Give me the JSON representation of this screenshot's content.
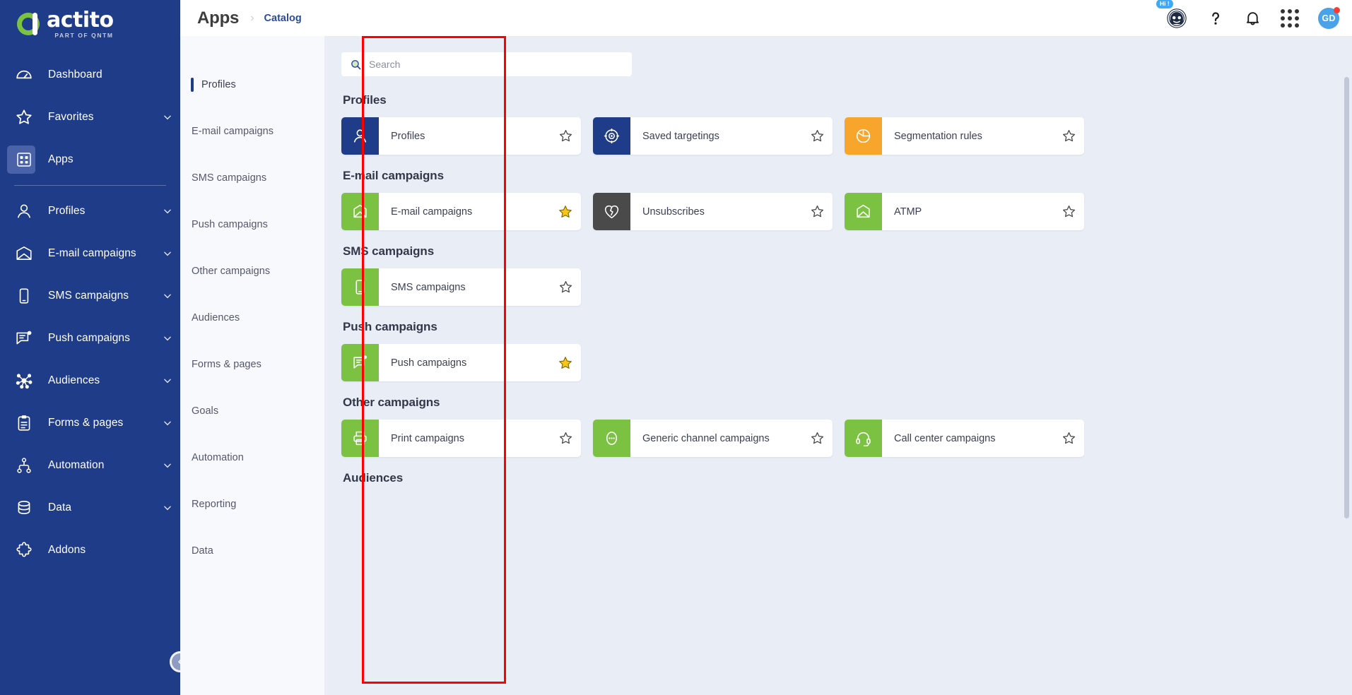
{
  "brand": {
    "name": "actito",
    "tagline": "PART OF QNTM",
    "sidebar_bg": "#1f3c88",
    "accent_green": "#7cc242",
    "accent_orange": "#f7a52b"
  },
  "sidebar": {
    "items": [
      {
        "label": "Dashboard",
        "icon": "dashboard-icon",
        "chevron": false,
        "active": false
      },
      {
        "label": "Favorites",
        "icon": "star-icon",
        "chevron": true,
        "active": false
      },
      {
        "label": "Apps",
        "icon": "apps-grid-icon",
        "chevron": false,
        "active": true
      },
      {
        "label": "Profiles",
        "icon": "person-icon",
        "chevron": true,
        "active": false
      },
      {
        "label": "E-mail campaigns",
        "icon": "envelope-icon",
        "chevron": true,
        "active": false
      },
      {
        "label": "SMS campaigns",
        "icon": "mobile-icon",
        "chevron": true,
        "active": false
      },
      {
        "label": "Push campaigns",
        "icon": "push-message-icon",
        "chevron": true,
        "active": false
      },
      {
        "label": "Audiences",
        "icon": "network-nodes-icon",
        "chevron": true,
        "active": false
      },
      {
        "label": "Forms & pages",
        "icon": "clipboard-icon",
        "chevron": true,
        "active": false
      },
      {
        "label": "Automation",
        "icon": "sitemap-icon",
        "chevron": true,
        "active": false
      },
      {
        "label": "Data",
        "icon": "database-icon",
        "chevron": true,
        "active": false
      },
      {
        "label": "Addons",
        "icon": "puzzle-icon",
        "chevron": false,
        "active": false
      }
    ],
    "collapse_icon": "chevron-left-icon"
  },
  "header": {
    "title": "Apps",
    "separator": "›",
    "breadcrumb_current": "Catalog",
    "icons": [
      {
        "name": "chatbot-icon",
        "badge": "Hi !"
      },
      {
        "name": "help-question-icon",
        "badge": ""
      },
      {
        "name": "notification-bell-icon",
        "badge": ""
      },
      {
        "name": "apps-grid-icon",
        "badge": ""
      }
    ],
    "avatar_initials": "GD",
    "avatar_color": "#4aa3e8",
    "avatar_dot_color": "#ff3b30"
  },
  "catalog_nav": {
    "highlight_color": "#ff0000",
    "items": [
      {
        "label": "Profiles",
        "active": true
      },
      {
        "label": "E-mail campaigns",
        "active": false
      },
      {
        "label": "SMS campaigns",
        "active": false
      },
      {
        "label": "Push campaigns",
        "active": false
      },
      {
        "label": "Other campaigns",
        "active": false
      },
      {
        "label": "Audiences",
        "active": false
      },
      {
        "label": "Forms & pages",
        "active": false
      },
      {
        "label": "Goals",
        "active": false
      },
      {
        "label": "Automation",
        "active": false
      },
      {
        "label": "Reporting",
        "active": false
      },
      {
        "label": "Data",
        "active": false
      }
    ]
  },
  "search": {
    "placeholder": "Search",
    "value": "",
    "icon": "search-icon"
  },
  "sections": [
    {
      "title": "Profiles",
      "cards": [
        {
          "label": "Profiles",
          "icon": "person-icon",
          "color": "bg-navy",
          "favorite": false
        },
        {
          "label": "Saved targetings",
          "icon": "target-icon",
          "color": "bg-navy",
          "favorite": false
        },
        {
          "label": "Segmentation rules",
          "icon": "pie-chart-icon",
          "color": "bg-orange",
          "favorite": false
        }
      ]
    },
    {
      "title": "E-mail campaigns",
      "cards": [
        {
          "label": "E-mail campaigns",
          "icon": "envelope-icon",
          "color": "bg-green",
          "favorite": true
        },
        {
          "label": "Unsubscribes",
          "icon": "broken-heart-icon",
          "color": "bg-dark",
          "favorite": false
        },
        {
          "label": "ATMP",
          "icon": "envelope-icon",
          "color": "bg-green",
          "favorite": false
        }
      ]
    },
    {
      "title": "SMS campaigns",
      "cards": [
        {
          "label": "SMS campaigns",
          "icon": "mobile-icon",
          "color": "bg-green",
          "favorite": false
        }
      ]
    },
    {
      "title": "Push campaigns",
      "cards": [
        {
          "label": "Push campaigns",
          "icon": "push-message-icon",
          "color": "bg-green",
          "favorite": true
        }
      ]
    },
    {
      "title": "Other campaigns",
      "cards": [
        {
          "label": "Print campaigns",
          "icon": "printer-icon",
          "color": "bg-green",
          "favorite": false
        },
        {
          "label": "Generic channel campaigns",
          "icon": "ellipsis-icon",
          "color": "bg-green",
          "favorite": false
        },
        {
          "label": "Call center campaigns",
          "icon": "headset-icon",
          "color": "bg-green",
          "favorite": false
        }
      ]
    },
    {
      "title": "Audiences",
      "cards": []
    }
  ]
}
